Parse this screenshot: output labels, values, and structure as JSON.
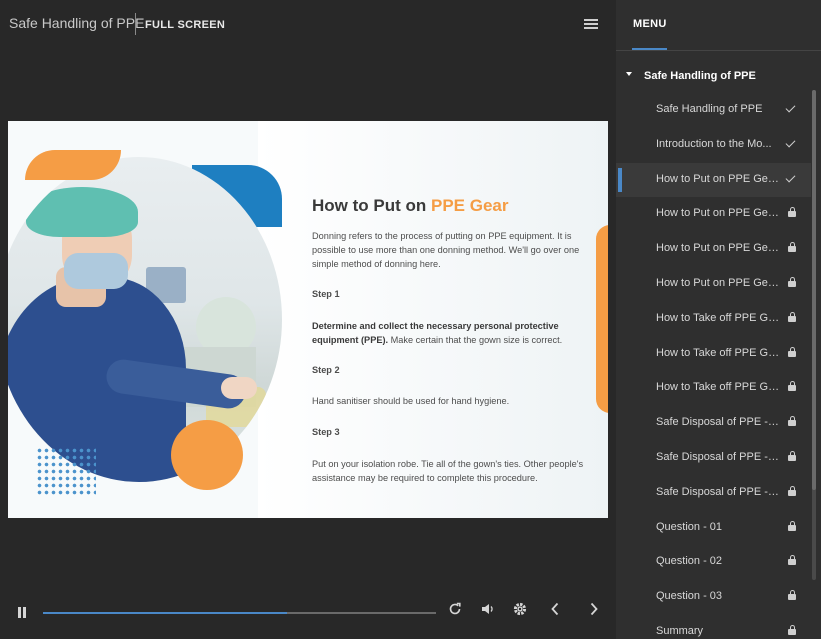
{
  "header": {
    "course_title": "Safe Handling of PPE",
    "fullscreen_label": "FULL SCREEN"
  },
  "slide": {
    "title_prefix": "How to Put on ",
    "title_accent": "PPE Gear",
    "intro": "Donning refers to the process of putting on PPE equipment. It is possible to use more than one donning method. We'll go over one simple method of donning here.",
    "step1_heading": "Step 1",
    "step1_bold": "Determine and collect the necessary personal protective equipment (PPE).",
    "step1_text": " Make certain that the gown size is correct.",
    "step2_heading": "Step 2",
    "step2_text": "Hand sanitiser should be used for hand hygiene.",
    "step3_heading": "Step 3",
    "step3_text": "Put on your isolation robe. Tie all of the gown's ties. Other people's assistance may be required to complete this procedure."
  },
  "player": {
    "progress_fraction": 0.62,
    "icons": [
      "pause-icon",
      "replay-icon",
      "volume-icon",
      "settings-icon",
      "previous-icon",
      "next-icon"
    ]
  },
  "menu": {
    "tab_label": "MENU",
    "section_title": "Safe Handling of PPE",
    "items": [
      {
        "label": "Safe Handling of PPE",
        "status": "done"
      },
      {
        "label": "Introduction to the Mo...",
        "status": "done"
      },
      {
        "label": "How to Put on PPE Gea...",
        "status": "done",
        "active": true
      },
      {
        "label": "How to Put on PPE Gea...",
        "status": "locked"
      },
      {
        "label": "How to Put on PPE Gea...",
        "status": "locked"
      },
      {
        "label": "How to Put on PPE Gea...",
        "status": "locked"
      },
      {
        "label": "How to Take off PPE Ge...",
        "status": "locked"
      },
      {
        "label": "How to Take off PPE Ge...",
        "status": "locked"
      },
      {
        "label": "How to Take off PPE Ge...",
        "status": "locked"
      },
      {
        "label": "Safe Disposal of PPE - 01",
        "status": "locked"
      },
      {
        "label": "Safe Disposal of PPE - 02",
        "status": "locked"
      },
      {
        "label": "Safe Disposal of PPE - 03",
        "status": "locked"
      },
      {
        "label": "Question - 01",
        "status": "locked"
      },
      {
        "label": "Question - 02",
        "status": "locked"
      },
      {
        "label": "Question - 03",
        "status": "locked"
      },
      {
        "label": "Summary",
        "status": "locked"
      }
    ]
  },
  "colors": {
    "accent": "#4a88c7",
    "orange": "#f59d45",
    "blue": "#1e7fc1"
  }
}
